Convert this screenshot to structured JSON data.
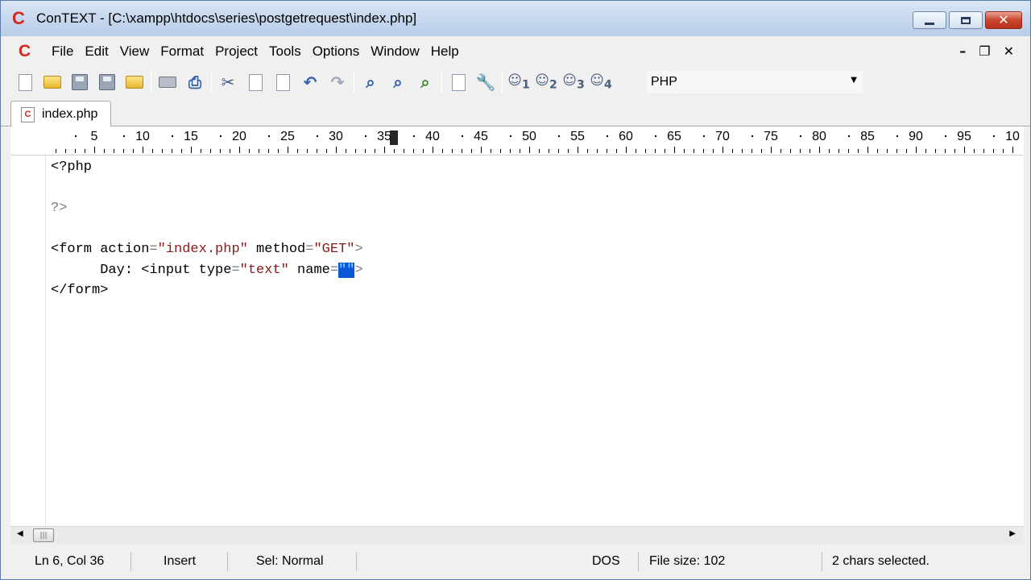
{
  "title_bar": {
    "app_logo": "C",
    "title": "ConTEXT - [C:\\xampp\\htdocs\\series\\postgetrequest\\index.php]"
  },
  "menu": {
    "logo": "C",
    "items": [
      "File",
      "Edit",
      "View",
      "Format",
      "Project",
      "Tools",
      "Options",
      "Window",
      "Help"
    ]
  },
  "toolbar": {
    "language": "PHP",
    "user_buttons": [
      "1",
      "2",
      "3",
      "4"
    ]
  },
  "tab": {
    "label": "index.php",
    "icon_letter": "C"
  },
  "ruler": {
    "numbers": [
      "5",
      "10",
      "15",
      "20",
      "25",
      "30",
      "35",
      "40",
      "45",
      "50",
      "55",
      "60",
      "65",
      "70",
      "75",
      "80",
      "85",
      "90",
      "95",
      "10"
    ],
    "current_column": 36
  },
  "code_lines": [
    {
      "parts": [
        {
          "t": "<?php",
          "c": "tag"
        }
      ]
    },
    {
      "parts": []
    },
    {
      "parts": [
        {
          "t": "?>",
          "c": "op"
        }
      ]
    },
    {
      "parts": []
    },
    {
      "parts": [
        {
          "t": "<form action",
          "c": "tag"
        },
        {
          "t": "=",
          "c": "op"
        },
        {
          "t": "\"index.php\"",
          "c": "str"
        },
        {
          "t": " method",
          "c": "tag"
        },
        {
          "t": "=",
          "c": "op"
        },
        {
          "t": "\"GET\"",
          "c": "str"
        },
        {
          "t": ">",
          "c": "op"
        }
      ]
    },
    {
      "parts": [
        {
          "t": "      Day: <input type",
          "c": "tag"
        },
        {
          "t": "=",
          "c": "op"
        },
        {
          "t": "\"text\"",
          "c": "str"
        },
        {
          "t": " name",
          "c": "tag"
        },
        {
          "t": "=",
          "c": "op"
        },
        {
          "t": "\"\"",
          "c": "sel"
        },
        {
          "t": ">",
          "c": "op"
        }
      ]
    },
    {
      "parts": [
        {
          "t": "</form>",
          "c": "tag"
        }
      ]
    }
  ],
  "status": {
    "position": "Ln 6, Col 36",
    "mode": "Insert",
    "selection_mode": "Sel: Normal",
    "line_ending": "DOS",
    "file_size": "File size: 102",
    "selection": "2 chars selected."
  }
}
